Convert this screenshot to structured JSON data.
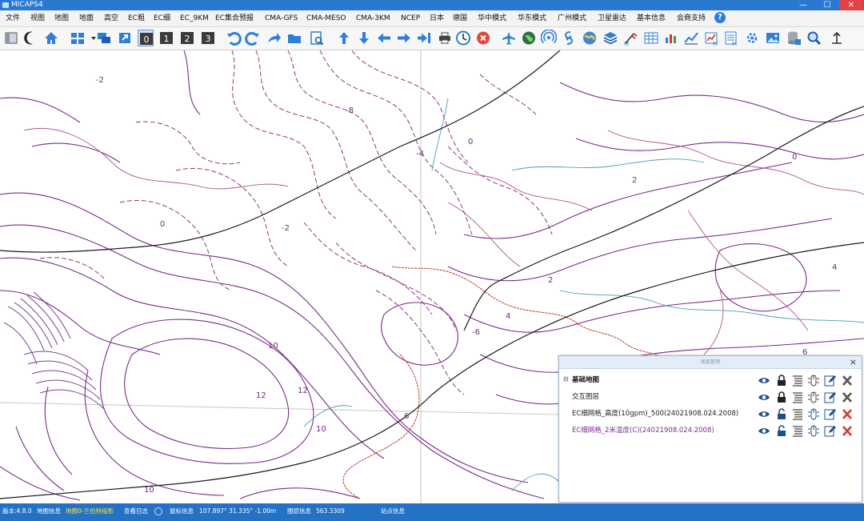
{
  "window": {
    "title": "MICAPS4",
    "minimize": "—",
    "maximize": "☐",
    "close": "✕"
  },
  "menu": {
    "items": [
      {
        "label": "文件"
      },
      {
        "label": "视图"
      },
      {
        "label": "地图"
      },
      {
        "label": "地面"
      },
      {
        "label": "高空"
      },
      {
        "label": "EC粗"
      },
      {
        "label": "EC细"
      },
      {
        "label": "EC_9KM"
      },
      {
        "label": "EC集合预报"
      },
      {
        "label": "CMA-GFS"
      },
      {
        "label": "CMA-MESO"
      },
      {
        "label": "CMA-3KM"
      },
      {
        "label": "NCEP"
      },
      {
        "label": "日本"
      },
      {
        "label": "德国"
      },
      {
        "label": "华中模式"
      },
      {
        "label": "华东模式"
      },
      {
        "label": "广州模式"
      },
      {
        "label": "卫星雷达"
      },
      {
        "label": "基本信息"
      },
      {
        "label": "会商支持"
      }
    ],
    "help_icon": "?"
  },
  "toolbar": {
    "numbered_views": [
      "1",
      "2",
      "3"
    ]
  },
  "map": {
    "contour_labels": [
      "-2",
      "-4",
      "-6",
      "-8",
      "0",
      "2",
      "4",
      "6",
      "8",
      "10",
      "12"
    ]
  },
  "layer_panel": {
    "title": "图层管理",
    "close": "×",
    "layers": [
      {
        "name": "基础地图",
        "color": "#111111",
        "bold": true,
        "locked": true
      },
      {
        "name": "交互图层",
        "color": "#222222",
        "bold": false,
        "locked": true
      },
      {
        "name": "EC细网格_高度(10gpm)_500(24021908.024.2008)",
        "color": "#222222",
        "bold": false,
        "locked": false
      },
      {
        "name": "EC细网格_2米温度(C)(24021908.024.2008)",
        "color": "#7b2b8c",
        "bold": false,
        "locked": false
      }
    ]
  },
  "statusbar": {
    "version": "版本:4.8.0",
    "map_info": "地图信息",
    "projection": "地图0-兰伯特投影",
    "log": "查看日志",
    "mouse_label": "鼠标信息",
    "mouse_value": "107.897° 31.335° -1.00m",
    "layer_label": "图层信息",
    "layer_value": "563.3309",
    "station": "站点信息"
  },
  "colors": {
    "accent": "#2372c6",
    "contour_solid": "#7b2b8c",
    "contour_dashed": "#8d3a7a",
    "border_red": "#c0392b"
  }
}
